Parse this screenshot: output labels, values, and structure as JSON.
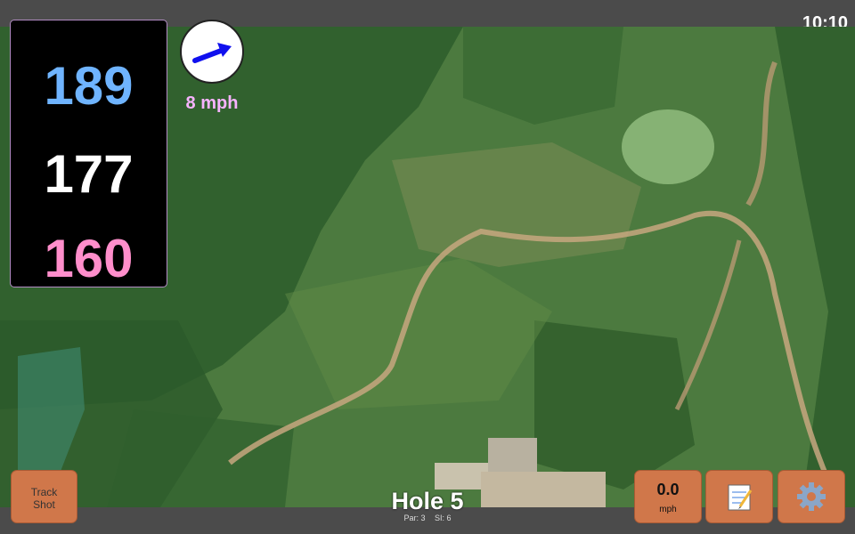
{
  "status": {
    "time": "10:10"
  },
  "distances": {
    "back": "189",
    "middle": "177",
    "front": "160"
  },
  "wind": {
    "speed_label": "8 mph",
    "arrow_icon": "wind-direction-arrow-icon"
  },
  "buttons": {
    "track_shot": "Track\nShot",
    "speed_value": "0.0",
    "speed_unit": "mph",
    "notes_icon": "notepad-icon",
    "settings_icon": "gear-icon"
  },
  "hole": {
    "title": "Hole 5",
    "par": "Par: 3",
    "si": "SI: 6"
  },
  "colors": {
    "back": "#6fb4ff",
    "middle": "#ffffff",
    "front": "#ff8ecb",
    "wind_text": "#f7b3ff",
    "button": "#d0774a",
    "bar": "#4b4b4b"
  }
}
